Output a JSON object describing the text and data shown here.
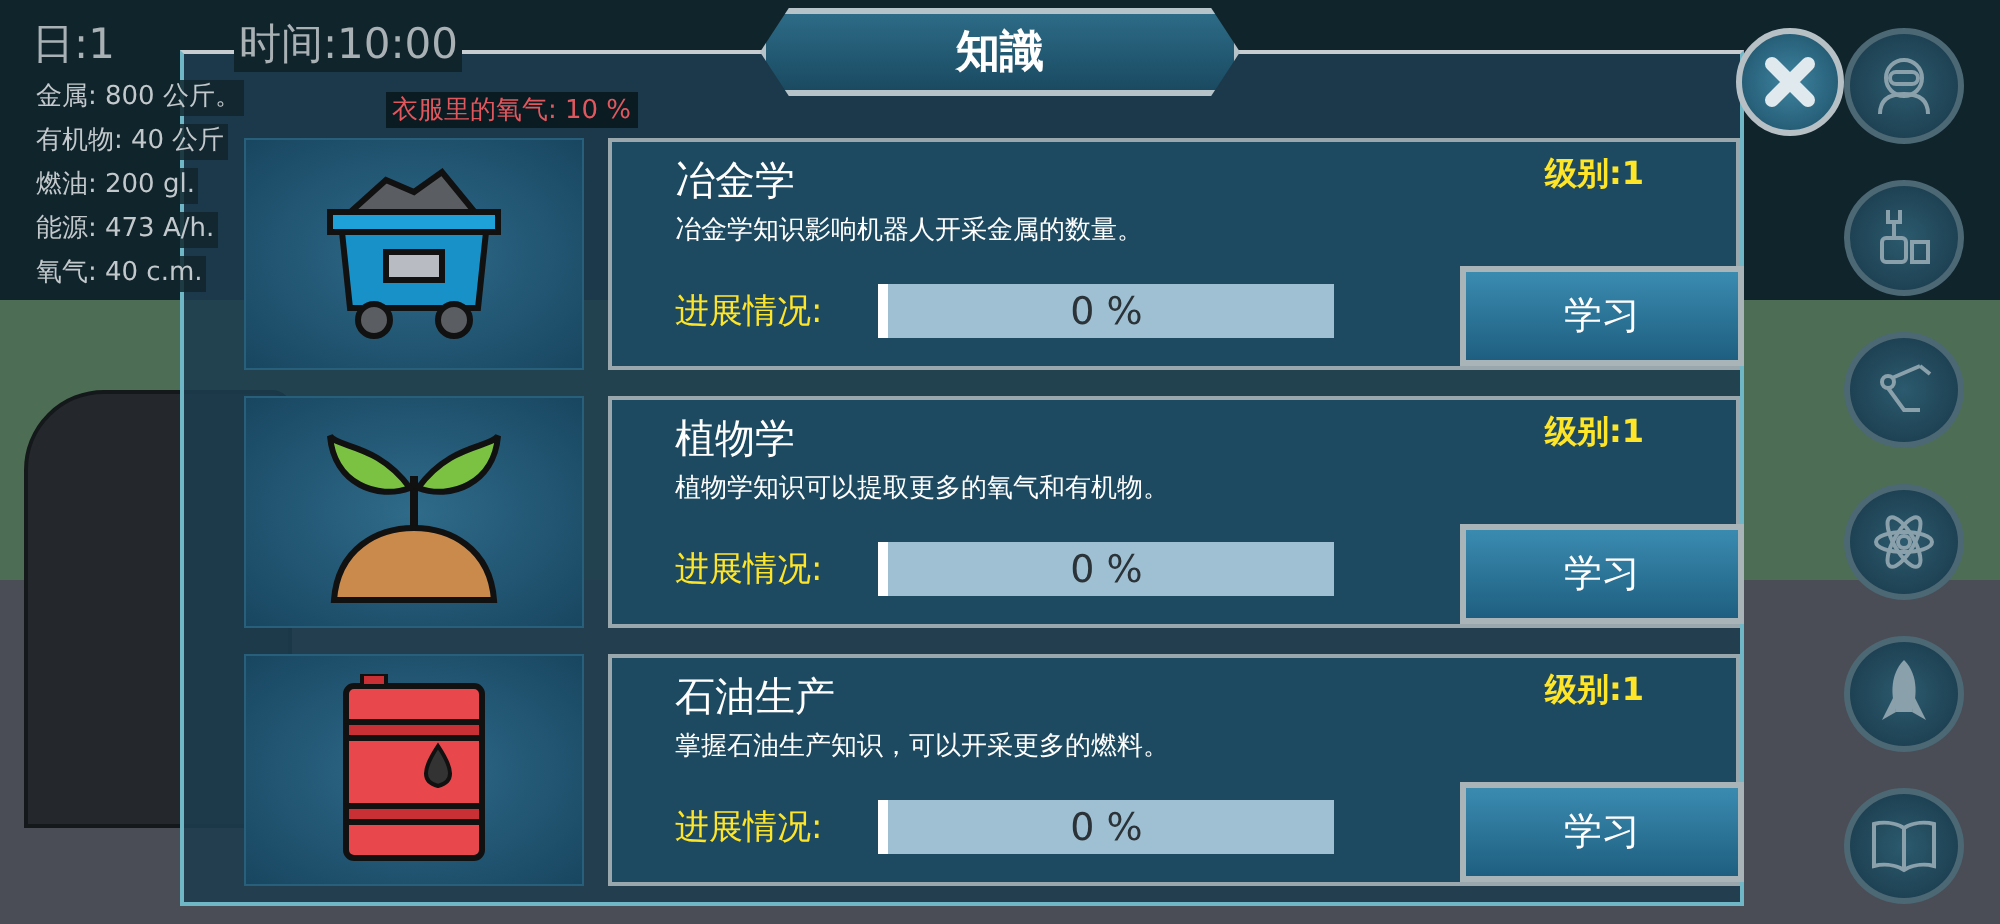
{
  "hud": {
    "day": "日:1",
    "time": "时间:10:00",
    "resources": [
      "金属: 800 公斤。",
      "有机物: 40 公斤",
      "燃油: 200 gl.",
      "能源: 473 A/h.",
      "氧气: 40 c.m."
    ],
    "warning": "衣服里的氧气: 10 %"
  },
  "dialog": {
    "title": "知識",
    "skills": [
      {
        "kind": "cart",
        "name": "冶金学",
        "rank": "级别:1",
        "description": "冶金学知识影响机器人开采金属的数量。",
        "progress_label": "进展情况:",
        "level": 0,
        "progress_text": "0 %",
        "button": "学习"
      },
      {
        "kind": "plant",
        "name": "植物学",
        "rank": "级别:1",
        "description": "植物学知识可以提取更多的氧气和有机物。",
        "progress_label": "进展情况:",
        "level": 0,
        "progress_text": "0 %",
        "button": "学习"
      },
      {
        "kind": "barrel",
        "name": "石油生产",
        "rank": "级别:1",
        "description": "掌握石油生产知识，可以开采更多的燃料。",
        "progress_label": "进展情况:",
        "level": 0,
        "progress_text": "0 %",
        "button": "学习"
      }
    ]
  }
}
